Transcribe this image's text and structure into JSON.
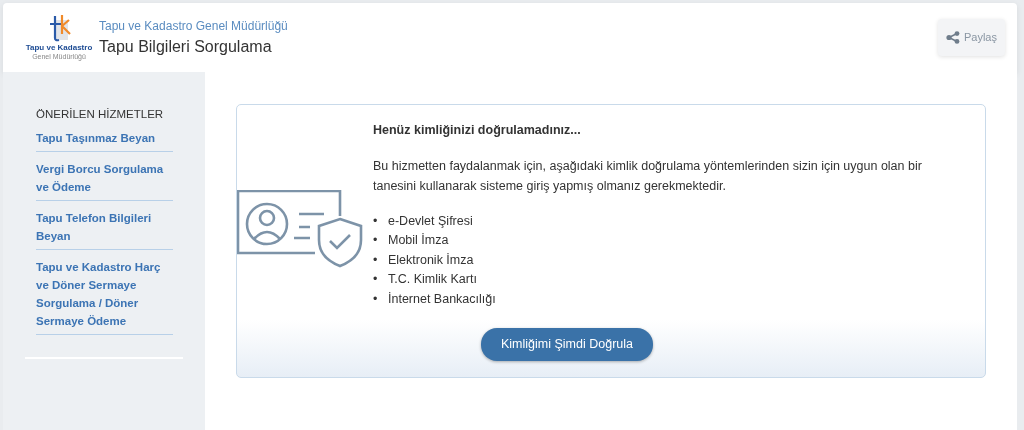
{
  "header": {
    "logo_text": "Tapu ve Kadastro",
    "logo_subtext": "Genel Müdürlüğü",
    "organization": "Tapu ve Kadastro Genel Müdürlüğü",
    "title": "Tapu Bilgileri Sorgulama",
    "share_button": "Paylaş"
  },
  "sidebar": {
    "heading": "ÖNERİLEN HİZMETLER",
    "items": [
      {
        "label": "Tapu Taşınmaz Beyan"
      },
      {
        "label": "Vergi Borcu Sorgulama ve Ödeme"
      },
      {
        "label": "Tapu Telefon Bilgileri Beyan"
      },
      {
        "label": "Tapu ve Kadastro Harç ve Döner Sermaye Sorgulama / Döner Sermaye Ödeme"
      }
    ]
  },
  "notice": {
    "title": "Henüz kimliğinizi doğrulamadınız...",
    "message": "Bu hizmetten faydalanmak için, aşağıdaki kimlik doğrulama yöntemlerinden sizin için uygun olan bir tanesini kullanarak sisteme giriş yapmış olmanız gerekmektedir.",
    "methods": [
      {
        "marker": "•",
        "label": "e-Devlet Şifresi"
      },
      {
        "marker": "•",
        "label": "Mobil İmza"
      },
      {
        "marker": "•",
        "label": "Elektronik İmza"
      },
      {
        "marker": "•",
        "label": "T.C. Kimlik Kartı"
      },
      {
        "marker": "•",
        "label": "İnternet Bankacılığı"
      }
    ],
    "button": "Kimliğimi Şimdi Doğrula"
  }
}
